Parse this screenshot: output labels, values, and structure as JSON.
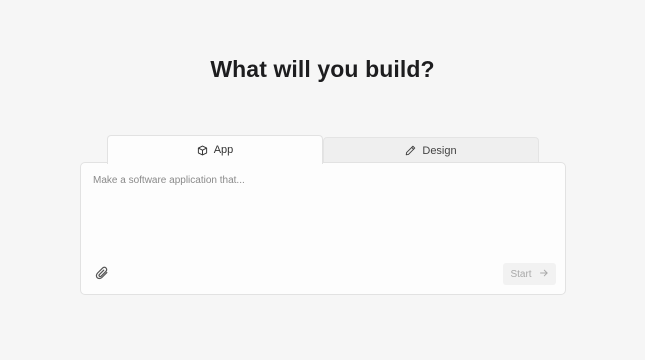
{
  "heading": "What will you build?",
  "tabs": [
    {
      "label": "App",
      "icon": "cube-icon",
      "active": true
    },
    {
      "label": "Design",
      "icon": "pen-icon",
      "active": false
    }
  ],
  "prompt": {
    "placeholder": "Make a software application that...",
    "value": ""
  },
  "actions": {
    "attach_icon": "paperclip-icon",
    "start_label": "Start",
    "start_icon": "arrow-right-icon"
  },
  "colors": {
    "background": "#f6f6f6",
    "card": "#fdfdfd",
    "inactive_tab": "#efefef",
    "heading": "#1d1d1f",
    "disabled_text": "#a9a9a9"
  }
}
